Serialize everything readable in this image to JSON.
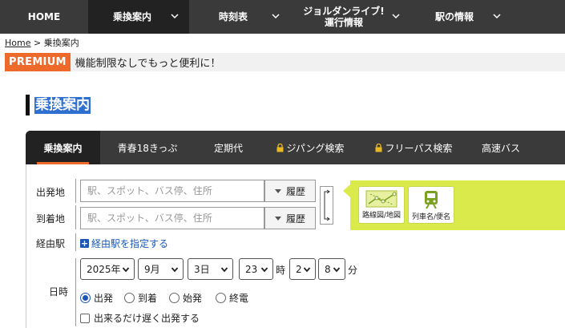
{
  "topnav": {
    "items": [
      {
        "label": "HOME"
      },
      {
        "label": "乗換案内"
      },
      {
        "label": "時刻表"
      },
      {
        "label": "ジョルダンライブ!\n運行情報"
      },
      {
        "label": "駅の情報"
      }
    ]
  },
  "breadcrumb": {
    "home": "Home",
    "separator": ">",
    "current": "乗換案内"
  },
  "premium": {
    "badge": "PREMIUM",
    "text": "機能制限なしでもっと便利に！"
  },
  "heading": {
    "title": "乗換案内"
  },
  "tabs": [
    {
      "label": "乗換案内"
    },
    {
      "label": "青春18きっぷ"
    },
    {
      "label": "定期代"
    },
    {
      "label": "ジパング検索"
    },
    {
      "label": "フリーパス検索"
    },
    {
      "label": "高速バス"
    }
  ],
  "form": {
    "from_label": "出発地",
    "to_label": "到着地",
    "via_label": "経由駅",
    "datetime_label": "日時",
    "from_placeholder": "駅、スポット、バス停、住所",
    "to_placeholder": "駅、スポット、バス停、住所",
    "history_label": "履歴",
    "via_link": "経由駅を指定する",
    "route_map_label": "路線図/地図",
    "train_name_label": "列車名/便名",
    "year": "2025年",
    "month": "9月",
    "day": "3日",
    "hour": "23",
    "hour_unit": "時",
    "min_tens": "2",
    "min_ones": "8",
    "min_unit": "分",
    "radio_options": [
      "出発",
      "到着",
      "始発",
      "終電"
    ],
    "late_departure": "出来るだけ遅く出発する"
  },
  "colors": {
    "nav_bg": "#3a3a3a",
    "premium_orange": "#ee6a2a",
    "link_blue": "#1a57b5",
    "panel_green": "#d9ea4a"
  }
}
